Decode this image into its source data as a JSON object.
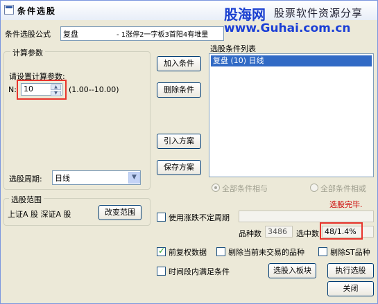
{
  "window": {
    "title": "条件选股"
  },
  "watermark": {
    "site_name": "股海网",
    "site_tagline": "股票软件资源分享",
    "site_url": "www.Guhai.com.cn"
  },
  "formula": {
    "label": "条件选股公式",
    "value": "复盘",
    "description": "- 1涨停2一字板3首阳4有堆量"
  },
  "params": {
    "group_title": "计算参数",
    "prompt": "请设置计算参数:",
    "n_label": "N:",
    "n_value": "10",
    "n_range": "(1.00--10.00)",
    "period_label": "选股周期:",
    "period_value": "日线"
  },
  "scope": {
    "group_title": "选股范围",
    "value": "上证A 股 深证A 股",
    "change_button": "改变范围"
  },
  "buttons": {
    "add_condition": "加入条件",
    "delete_condition": "删除条件",
    "import_plan": "引入方案",
    "save_plan": "保存方案",
    "add_to_block": "选股入板块",
    "run_selection": "执行选股",
    "close": "关闭"
  },
  "conditions": {
    "list_title": "选股条件列表",
    "items": [
      "复盘 (10) 日线"
    ],
    "radio_all_and": "全部条件相与",
    "radio_all_or": "全部条件相或"
  },
  "status": {
    "message": "选股完毕."
  },
  "options": {
    "use_variable_period": "使用涨跌不定周期",
    "count_label": "品种数",
    "count_value": "3486",
    "selected_label": "选中数",
    "selected_value": "48/1.4%",
    "forward_adjust": "前复权数据",
    "exclude_untraded": "剔除当前未交易的品种",
    "exclude_st": "剔除ST品种",
    "satisfy_in_period": "时间段内满足条件"
  },
  "colors": {
    "status_text": "#cc0000",
    "highlight_box": "#e8342c",
    "selection_bg": "#316ac5"
  }
}
